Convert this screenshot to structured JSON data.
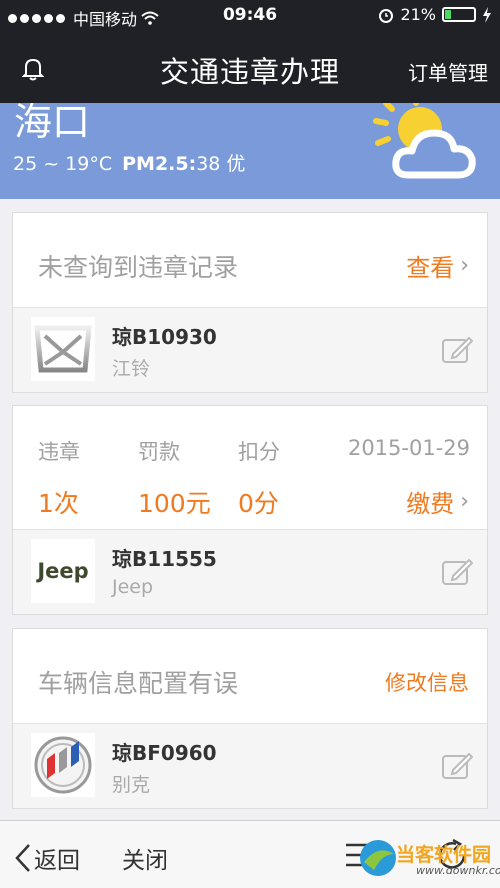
{
  "status_bar": {
    "carrier": "中国移动",
    "time": "09:46",
    "battery": "21%",
    "battery_level": 0.21
  },
  "nav": {
    "title": "交通违章办理",
    "right_label": "订单管理"
  },
  "weather": {
    "city": "海口",
    "temp": "25 ~ 19°C",
    "pm_label": "PM2.5:",
    "pm_value": "38 优"
  },
  "cards": [
    {
      "head_text": "未查询到违章记录",
      "head_link": "查看",
      "plate": "琼B10930",
      "brand": "江铃"
    },
    {
      "labels": {
        "violation": "违章",
        "fine": "罚款",
        "points": "扣分"
      },
      "date": "2015-01-29",
      "values": {
        "violation": "1次",
        "fine": "100元",
        "points": "0分"
      },
      "pay_link": "缴费",
      "plate": "琼B11555",
      "brand": "Jeep",
      "logo_text": "Jeep"
    },
    {
      "head_text": "车辆信息配置有误",
      "head_link": "修改信息",
      "plate": "琼BF0960",
      "brand": "别克"
    }
  ],
  "bottom": {
    "back": "返回",
    "close": "关闭"
  },
  "watermark": {
    "text": "当客软件园",
    "url": "www.downkr.com"
  },
  "colors": {
    "accent": "#f07a20",
    "header": "#1f2126",
    "weather_bg": "#7a9ad9"
  }
}
